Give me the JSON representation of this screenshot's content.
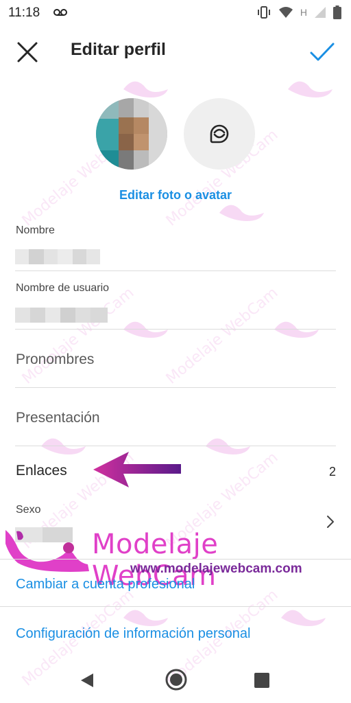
{
  "status_bar": {
    "time": "11:18",
    "network_label": "H"
  },
  "header": {
    "title": "Editar perfil",
    "close_icon": "close-icon",
    "confirm_icon": "checkmark-icon"
  },
  "profile": {
    "edit_photo_label": "Editar foto o avatar"
  },
  "fields": {
    "name_label": "Nombre",
    "username_label": "Nombre de usuario",
    "pronouns_placeholder": "Pronombres",
    "bio_placeholder": "Presentación",
    "links_label": "Enlaces",
    "links_count": "2",
    "gender_label": "Sexo"
  },
  "actions": {
    "switch_professional": "Cambiar a cuenta profesional",
    "personal_info_settings": "Configuración de información personal"
  },
  "watermark": {
    "brand": "Modelaje WebCam",
    "url": "www.modelajewebcam.com"
  },
  "colors": {
    "accent_blue": "#1a8fe3",
    "watermark_pink": "#e040c8",
    "watermark_purple": "#7a2a9a",
    "arrow_gradient_start": "#c0309a",
    "arrow_gradient_end": "#5a1a8a"
  }
}
